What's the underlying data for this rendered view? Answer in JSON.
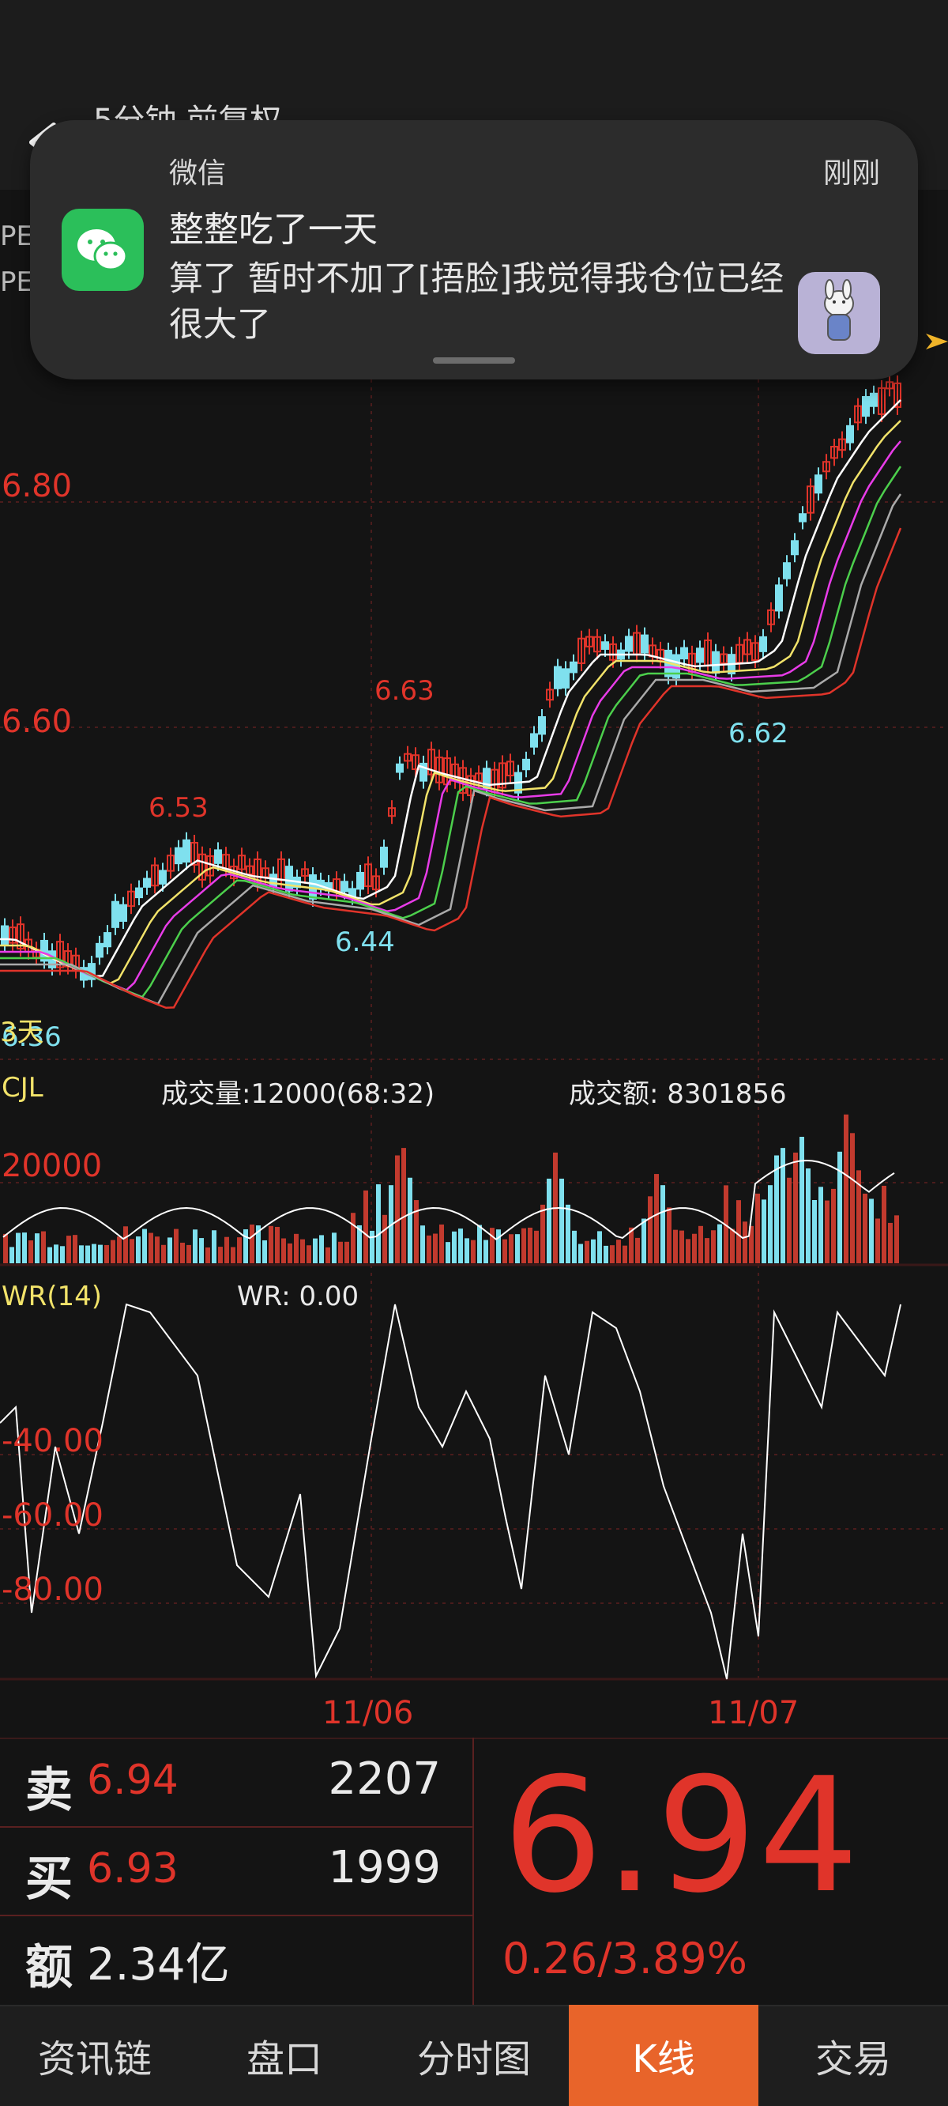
{
  "header": {
    "title": "5分钟 前复权",
    "left_tags": [
      "PE",
      "PE"
    ]
  },
  "notification": {
    "app": "微信",
    "time": "刚刚",
    "title": "整整吃了一天",
    "body": "算了 暂时不加了[捂脸]我觉得我仓位已经很大了"
  },
  "price_axis": {
    "labels": [
      "6.80",
      "6.60"
    ],
    "min_label": "6.36"
  },
  "annotations": {
    "high1": "6.53",
    "low1": "6.44",
    "high2": "6.63",
    "low2": "6.62",
    "days_tag": "3天"
  },
  "volume_panel": {
    "name": "CJL",
    "volume_text": "成交量:12000(68:32)",
    "amount_text": "成交额: 8301856",
    "axis_label": "20000"
  },
  "wr_panel": {
    "name": "WR(14)",
    "value_text": "WR: 0.00",
    "axis_labels": [
      "-40.00",
      "-60.00",
      "-80.00"
    ]
  },
  "dates": [
    "11/06",
    "11/07"
  ],
  "quotes": {
    "sell_label": "卖",
    "sell_price": "6.94",
    "sell_volume": "2207",
    "buy_label": "买",
    "buy_price": "6.93",
    "buy_volume": "1999",
    "amount_label": "额",
    "amount_value": "2.34亿",
    "last_price": "6.94",
    "change": "0.26/3.89%"
  },
  "tabs": [
    {
      "label": "资讯链",
      "active": false
    },
    {
      "label": "盘口",
      "active": false
    },
    {
      "label": "分时图",
      "active": false
    },
    {
      "label": "K线",
      "active": true
    },
    {
      "label": "交易",
      "active": false
    }
  ],
  "colors": {
    "up": "#e0342a",
    "down": "#7fe0ee",
    "accent": "#e8642a",
    "wechat": "#2bbf5a"
  }
}
